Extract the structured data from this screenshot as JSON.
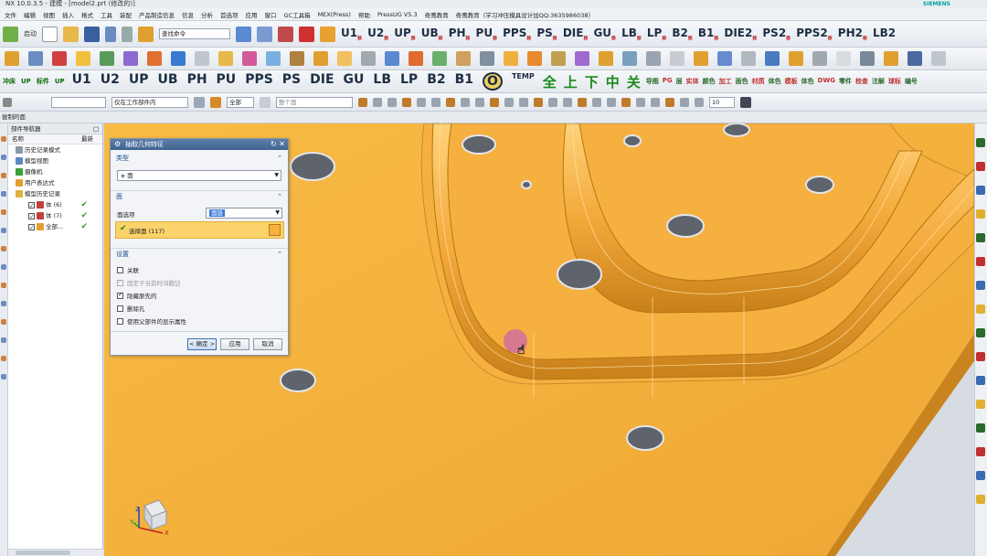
{
  "window": {
    "title": "NX 10.0.3.5 - 建模 - [model2.prt (修改的)]",
    "brand": "SIEMENS"
  },
  "menu": [
    "文件",
    "编辑",
    "视图",
    "插入",
    "格式",
    "工具",
    "装配",
    "产品制造信息",
    "信息",
    "分析",
    "首选项",
    "应用",
    "窗口",
    "GC工具箱",
    "MEX(Press)",
    "帮助",
    "PressUG V5.3",
    "奇鹰教育",
    "奇鹰教育（学习冲压模具设计加QQ:3635986038）"
  ],
  "toolbar": {
    "start_label": "启动",
    "search_placeholder": "查找命令",
    "row1_labels": [
      {
        "main": "U1",
        "sub": "移"
      },
      {
        "main": "U2",
        "sub": "移"
      },
      {
        "main": "UP",
        "sub": "移"
      },
      {
        "main": "UB",
        "sub": "移"
      },
      {
        "main": "PH",
        "sub": "移"
      },
      {
        "main": "PU",
        "sub": "移"
      },
      {
        "main": "PPS",
        "sub": "移"
      },
      {
        "main": "PS",
        "sub": "移"
      },
      {
        "main": "DIE",
        "sub": "移"
      },
      {
        "main": "GU",
        "sub": "移"
      },
      {
        "main": "LB",
        "sub": "移"
      },
      {
        "main": "LP",
        "sub": "移"
      },
      {
        "main": "B2",
        "sub": "移"
      },
      {
        "main": "B1",
        "sub": "移"
      },
      {
        "main": "DIE2",
        "sub": "移"
      },
      {
        "main": "PS2",
        "sub": "移"
      },
      {
        "main": "PPS2",
        "sub": "移"
      },
      {
        "main": "PH2",
        "sub": "移"
      },
      {
        "main": "LB2",
        "sub": ""
      }
    ],
    "row3_left": [
      "冲床",
      "UP",
      "标件",
      "UP"
    ],
    "row3_labels": [
      "U1",
      "U2",
      "UP",
      "UB",
      "PH",
      "PU",
      "PPS",
      "PS",
      "DIE",
      "GU",
      "LB",
      "LP",
      "B2",
      "B1",
      "O",
      "TEMP"
    ],
    "row3_cn": [
      "全",
      "上",
      "下",
      "中",
      "关"
    ],
    "row3_right": [
      "导图",
      "PG",
      "层",
      "实体",
      "颜色",
      "加工",
      "面色",
      "材质",
      "体色",
      "模板",
      "体色",
      "DWG",
      "零件",
      "检查",
      "注解",
      "球标",
      "编号"
    ],
    "filter_label": "仅在工作部件内",
    "filter_all": "全部",
    "face_select": "整个面",
    "zoom_value": "10"
  },
  "tabstrip": {
    "label": "拔制的面"
  },
  "navigator": {
    "title": "部件导航器",
    "col_name": "名称",
    "col_latest": "最新",
    "items": [
      {
        "label": "历史记录模式",
        "indent": 8
      },
      {
        "label": "模型视图",
        "indent": 8
      },
      {
        "label": "摄像机",
        "indent": 8
      },
      {
        "label": "用户表达式",
        "indent": 8
      },
      {
        "label": "模型历史记录",
        "indent": 8
      },
      {
        "label": "体 (6)",
        "indent": 22,
        "check": true,
        "latest": true
      },
      {
        "label": "体 (7)",
        "indent": 22,
        "check": true,
        "latest": true
      },
      {
        "label": "全部...",
        "indent": 22,
        "check": true,
        "latest": true
      }
    ]
  },
  "dialog": {
    "title": "抽取几何特征",
    "type_section": "类型",
    "type_value": "面",
    "face_section": "面",
    "face_option_label": "面选项",
    "face_option_value": "面链",
    "select_face_label": "选择面 (117)",
    "settings_section": "设置",
    "options": [
      {
        "label": "关联",
        "checked": false,
        "disabled": false
      },
      {
        "label": "固定于当前时间戳记",
        "checked": true,
        "disabled": true
      },
      {
        "label": "隐藏原先的",
        "checked": true,
        "disabled": false
      },
      {
        "label": "删除孔",
        "checked": false,
        "disabled": false
      },
      {
        "label": "使用父部件的显示属性",
        "checked": false,
        "disabled": false
      }
    ],
    "ok_label": "< 确定 >",
    "apply_label": "应用",
    "cancel_label": "取消"
  },
  "axes": {
    "x": "X",
    "y": "Y",
    "z": "Z"
  },
  "colors": {
    "part": "#f6b23d",
    "part_dark": "#d98e1e",
    "accent": "#3f6392",
    "check": "#2ba02b"
  }
}
